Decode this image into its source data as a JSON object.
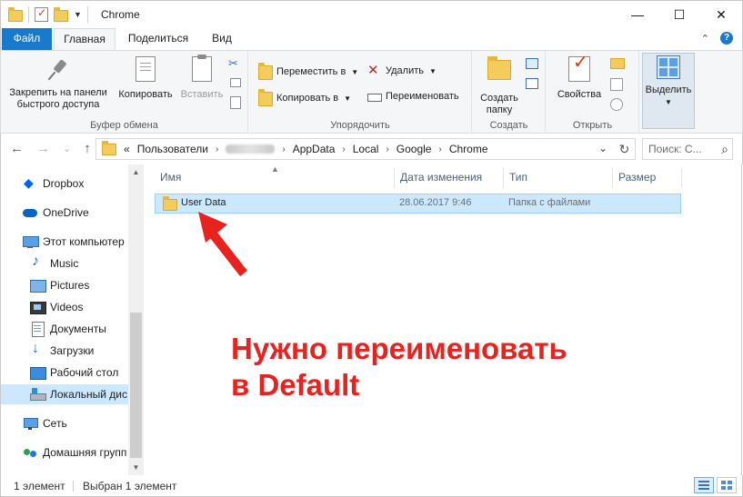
{
  "window": {
    "title": "Chrome",
    "controls": {
      "minimize": "—",
      "maximize": "☐",
      "close": "✕"
    }
  },
  "ribbon_tabs": {
    "file": "Файл",
    "home": "Главная",
    "share": "Поделиться",
    "view": "Вид",
    "collapse": "⌃",
    "help": "?"
  },
  "ribbon": {
    "clipboard": {
      "label": "Буфер обмена",
      "pin": "Закрепить на панели быстрого доступа",
      "copy": "Копировать",
      "paste": "Вставить"
    },
    "organize": {
      "label": "Упорядочить",
      "move_to": "Переместить в",
      "copy_to": "Копировать в",
      "delete": "Удалить",
      "rename": "Переименовать"
    },
    "new": {
      "label": "Создать",
      "new_folder": "Создать папку"
    },
    "open": {
      "label": "Открыть",
      "properties": "Свойства"
    },
    "select": {
      "label": "Выделить"
    }
  },
  "addressbar": {
    "back": "←",
    "forward": "→",
    "recent": "⌄",
    "up": "↑",
    "overflow": "«",
    "crumbs": [
      "Пользователи",
      "AppData",
      "Local",
      "Google",
      "Chrome"
    ],
    "separator": "›",
    "dropdown": "⌄",
    "refresh": "↻",
    "search_placeholder": "Поиск: С...",
    "search_icon": "⌕"
  },
  "navpane": {
    "items": [
      {
        "label": "Dropbox",
        "icon": "dropbox-icon"
      },
      {
        "label": "OneDrive",
        "icon": "onedrive-icon"
      },
      {
        "label": "Этот компьютер",
        "icon": "computer-icon"
      },
      {
        "label": "Music",
        "icon": "music-icon"
      },
      {
        "label": "Pictures",
        "icon": "pictures-icon"
      },
      {
        "label": "Videos",
        "icon": "videos-icon"
      },
      {
        "label": "Документы",
        "icon": "documents-icon"
      },
      {
        "label": "Загрузки",
        "icon": "downloads-icon"
      },
      {
        "label": "Рабочий стол",
        "icon": "desktop-icon"
      },
      {
        "label": "Локальный дис",
        "icon": "local-disk-icon"
      },
      {
        "label": "Сеть",
        "icon": "network-icon"
      },
      {
        "label": "Домашняя групп",
        "icon": "homegroup-icon"
      }
    ]
  },
  "filelist": {
    "columns": {
      "name": "Имя",
      "date": "Дата изменения",
      "type": "Тип",
      "size": "Размер"
    },
    "rows": [
      {
        "name": "User Data",
        "date": "28.06.2017 9:46",
        "type": "Папка с файлами",
        "size": ""
      }
    ]
  },
  "annotation": {
    "line1": "Нужно переименовать",
    "line2": "в Default",
    "color": "#e8231f"
  },
  "statusbar": {
    "count": "1 элемент",
    "selected": "Выбран 1 элемент"
  },
  "colors": {
    "file_tab": "#1979ca",
    "selection": "#cce8ff",
    "accent": "#0078d7"
  }
}
